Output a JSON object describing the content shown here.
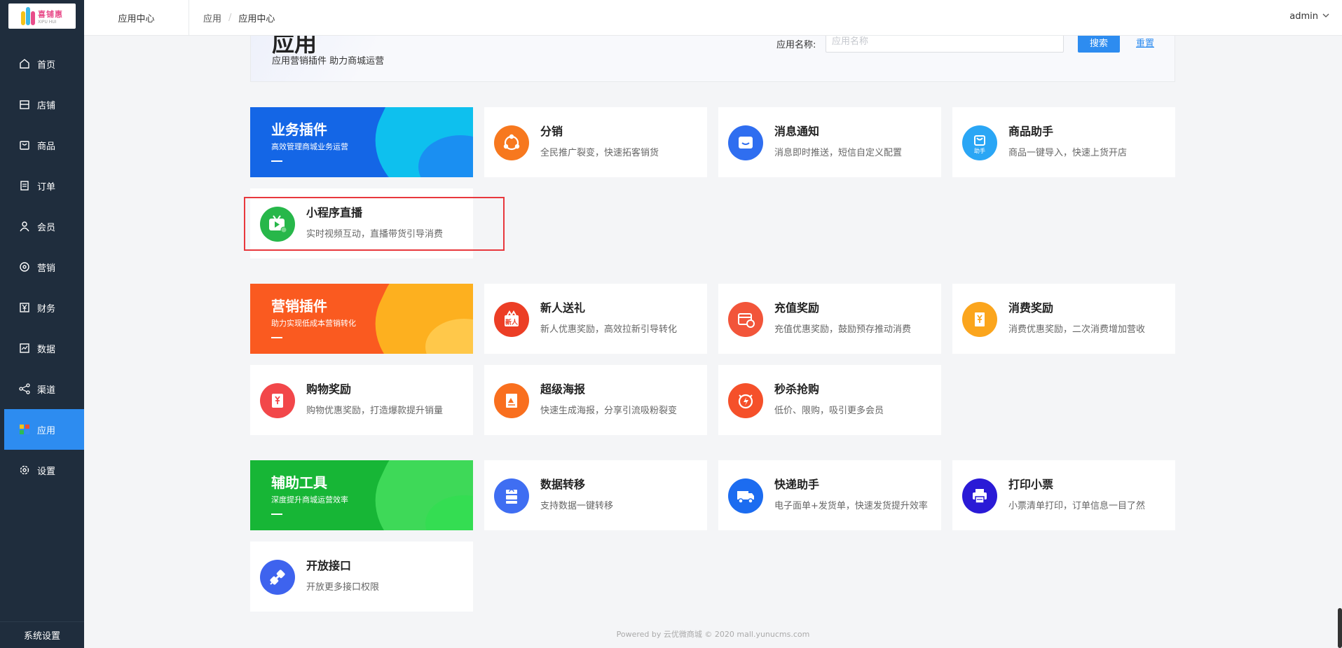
{
  "logo": {
    "text": "喜铺惠",
    "subtext": "XIPU HUI"
  },
  "sidebar": {
    "items": [
      {
        "label": "首页",
        "icon": "home-icon"
      },
      {
        "label": "店铺",
        "icon": "store-icon"
      },
      {
        "label": "商品",
        "icon": "bag-icon"
      },
      {
        "label": "订单",
        "icon": "order-icon"
      },
      {
        "label": "会员",
        "icon": "user-icon"
      },
      {
        "label": "营销",
        "icon": "marketing-icon"
      },
      {
        "label": "财务",
        "icon": "yen-icon"
      },
      {
        "label": "数据",
        "icon": "chart-icon"
      },
      {
        "label": "渠道",
        "icon": "share-icon"
      },
      {
        "label": "应用",
        "icon": "apps-icon",
        "active": true
      },
      {
        "label": "设置",
        "icon": "gear-icon"
      }
    ],
    "bottom": "系统设置"
  },
  "header": {
    "title": "应用中心",
    "breadcrumb": [
      "应用",
      "应用中心"
    ],
    "user": "admin"
  },
  "banner": {
    "title": "应用",
    "subtitle": "应用营销插件 助力商城运营",
    "search_label": "应用名称:",
    "search_placeholder": "应用名称",
    "search_button": "搜索",
    "reset": "重置"
  },
  "categories": [
    {
      "title": "业务插件",
      "subtitle": "高效管理商城业务运营",
      "color": "#1a6ff2"
    },
    {
      "title": "营销插件",
      "subtitle": "助力实现低成本营销转化",
      "color": "#fb6d1f"
    },
    {
      "title": "辅助工具",
      "subtitle": "深度提升商城运营效率",
      "color": "#1fc23f"
    }
  ],
  "apps": {
    "fenxiao": {
      "title": "分销",
      "desc": "全民推广裂变，快速拓客销货",
      "color": "#f7781e",
      "icon": "distribution-icon"
    },
    "xiaoxi": {
      "title": "消息通知",
      "desc": "消息即时推送，短信自定义配置",
      "color": "#2f6ef0",
      "icon": "message-icon"
    },
    "shangpin": {
      "title": "商品助手",
      "desc": "商品一键导入，快速上货开店",
      "color": "#2aa6f5",
      "icon": "goods-helper-icon",
      "badge": "助手"
    },
    "zhibo": {
      "title": "小程序直播",
      "desc": "实时视频互动，直播带货引导消费",
      "color": "#27b74a",
      "icon": "live-tv-icon"
    },
    "xinren": {
      "title": "新人送礼",
      "desc": "新人优惠奖励，高效拉新引导转化",
      "color": "#ec3e25",
      "icon": "gift-icon",
      "badge": "新人"
    },
    "chongzhi": {
      "title": "充值奖励",
      "desc": "充值优惠奖励，鼓励预存推动消费",
      "color": "#f2553a",
      "icon": "recharge-icon"
    },
    "xiaofei": {
      "title": "消费奖励",
      "desc": "消费优惠奖励，二次消费增加营收",
      "color": "#fba51d",
      "icon": "consume-icon"
    },
    "gouwu": {
      "title": "购物奖励",
      "desc": "购物优惠奖励，打造爆款提升销量",
      "color": "#f2474a",
      "icon": "shopping-icon"
    },
    "haibao": {
      "title": "超级海报",
      "desc": "快速生成海报，分享引流吸粉裂变",
      "color": "#f96f1e",
      "icon": "poster-icon"
    },
    "miaosha": {
      "title": "秒杀抢购",
      "desc": "低价、限购，吸引更多会员",
      "color": "#f5502a",
      "icon": "flash-sale-icon"
    },
    "zhuanyi": {
      "title": "数据转移",
      "desc": "支持数据一键转移",
      "color": "#3f6ef2",
      "icon": "data-transfer-icon"
    },
    "kuaidi": {
      "title": "快递助手",
      "desc": "电子面单+发货单，快速发货提升效率",
      "color": "#1c6cf0",
      "icon": "truck-icon"
    },
    "dayin": {
      "title": "打印小票",
      "desc": "小票清单打印，订单信息一目了然",
      "color": "#2a1ad6",
      "icon": "printer-icon"
    },
    "jiekou": {
      "title": "开放接口",
      "desc": "开放更多接口权限",
      "color": "#3e63ee",
      "icon": "api-plug-icon"
    }
  },
  "footer": "Powered by 云优微商城 © 2020 mall.yunucms.com"
}
